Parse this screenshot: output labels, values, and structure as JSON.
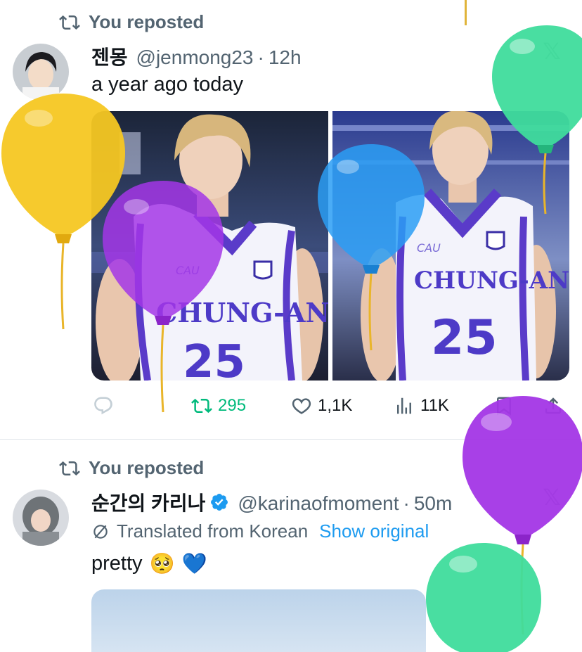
{
  "colors": {
    "repost_green": "#00ba7c",
    "link_blue": "#1d9bf0",
    "secondary_gray": "#536471",
    "balloon_yellow": "#f5c722",
    "balloon_purple": "#a336e6",
    "balloon_blue": "#2a9df4",
    "balloon_teal": "#3fdc9c"
  },
  "post1": {
    "repost_label": "You reposted",
    "display_name": "젠몽",
    "handle": "@jenmong23",
    "separator": "·",
    "time": "12h",
    "text": "a year ago today",
    "jersey_team": "CHUNG-ANG",
    "jersey_number": "25",
    "jersey_small": "CAU",
    "actions": {
      "replies": "",
      "reposts": "295",
      "likes": "1,1K",
      "views": "11K"
    }
  },
  "post2": {
    "repost_label": "You reposted",
    "display_name": "순간의 카리나",
    "handle": "@karinaofmoment",
    "separator": "·",
    "time": "50m",
    "translated_label": "Translated from Korean",
    "show_original": "Show original",
    "text": "pretty",
    "emoji1": "🥺",
    "emoji2": "💙"
  },
  "icons": {
    "repost": "repost-icon",
    "reply": "reply-icon",
    "like": "heart-icon",
    "views": "views-icon",
    "bookmark": "bookmark-icon",
    "share": "share-icon",
    "verified": "verified-badge-icon",
    "x_logo": "x-logo-icon",
    "globe_slash": "translate-icon"
  }
}
